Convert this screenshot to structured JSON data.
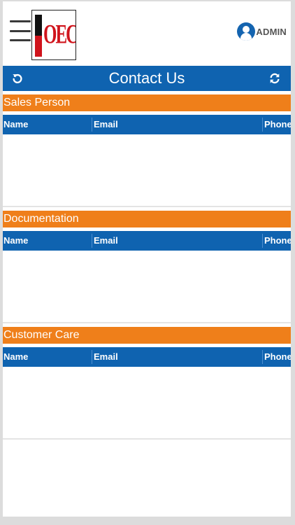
{
  "header": {
    "logo_text": "OECL",
    "user_name": "ADMIN"
  },
  "titlebar": {
    "title": "Contact Us",
    "back_icon": "undo-icon",
    "refresh_icon": "refresh-icon"
  },
  "sections": [
    {
      "title": "Sales Person",
      "columns": [
        "Name",
        "Email",
        "Phone"
      ]
    },
    {
      "title": "Documentation",
      "columns": [
        "Name",
        "Email",
        "Phone"
      ]
    },
    {
      "title": "Customer Care",
      "columns": [
        "Name",
        "Email",
        "Phone"
      ]
    }
  ],
  "colors": {
    "primary_blue": "#0f63b0",
    "section_orange": "#ef7f1a",
    "logo_red": "#d0141c"
  }
}
